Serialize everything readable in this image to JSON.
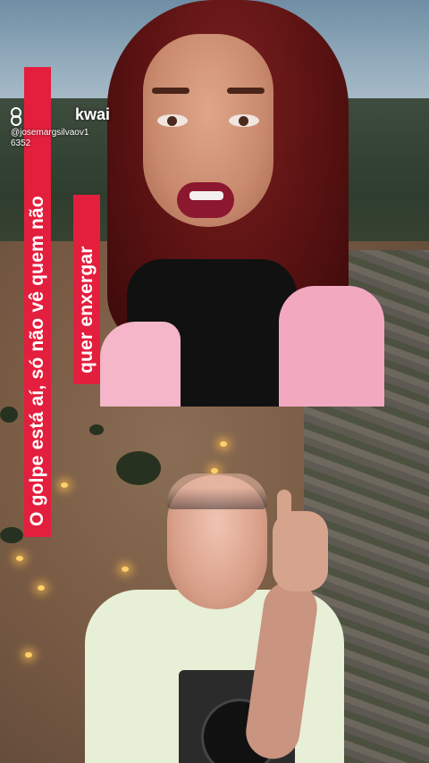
{
  "caption": {
    "line1": "O golpe está aí, só não vê quem não",
    "line2": "quer enxergar"
  },
  "watermark": {
    "brand": "kwai",
    "handle": "@josemargsilvaov1",
    "handle_line2": "6352",
    "logo_icon": "kwai-logo-icon"
  },
  "colors": {
    "caption_background": "#e31f3d",
    "caption_text": "#ffffff"
  }
}
